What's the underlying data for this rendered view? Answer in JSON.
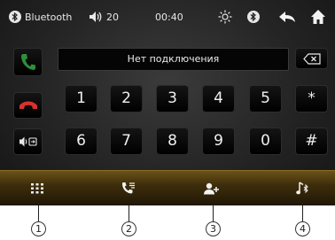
{
  "status": {
    "source_label": "Bluetooth",
    "volume": "20",
    "time": "00:40"
  },
  "display": {
    "text": "Нет подключения"
  },
  "keypad": {
    "row1": [
      "1",
      "2",
      "3",
      "4",
      "5",
      "*"
    ],
    "row2": [
      "6",
      "7",
      "8",
      "9",
      "0",
      "#"
    ]
  },
  "callouts": [
    "1",
    "2",
    "3",
    "4"
  ],
  "icons": {
    "status": [
      "bluetooth-icon",
      "volume-icon",
      "brightness-icon",
      "bluetooth-connection-icon",
      "back-icon",
      "home-icon"
    ],
    "left": [
      "call-answer-icon",
      "call-hangup-icon",
      "audio-transfer-icon"
    ],
    "bottom": [
      "dialpad-icon",
      "call-log-icon",
      "contacts-icon",
      "bluetooth-music-icon"
    ],
    "backspace": "backspace-icon"
  },
  "colors": {
    "answer": "#2f8f3a",
    "hangup": "#d8322c",
    "bottom_bar": "#5a4414"
  }
}
